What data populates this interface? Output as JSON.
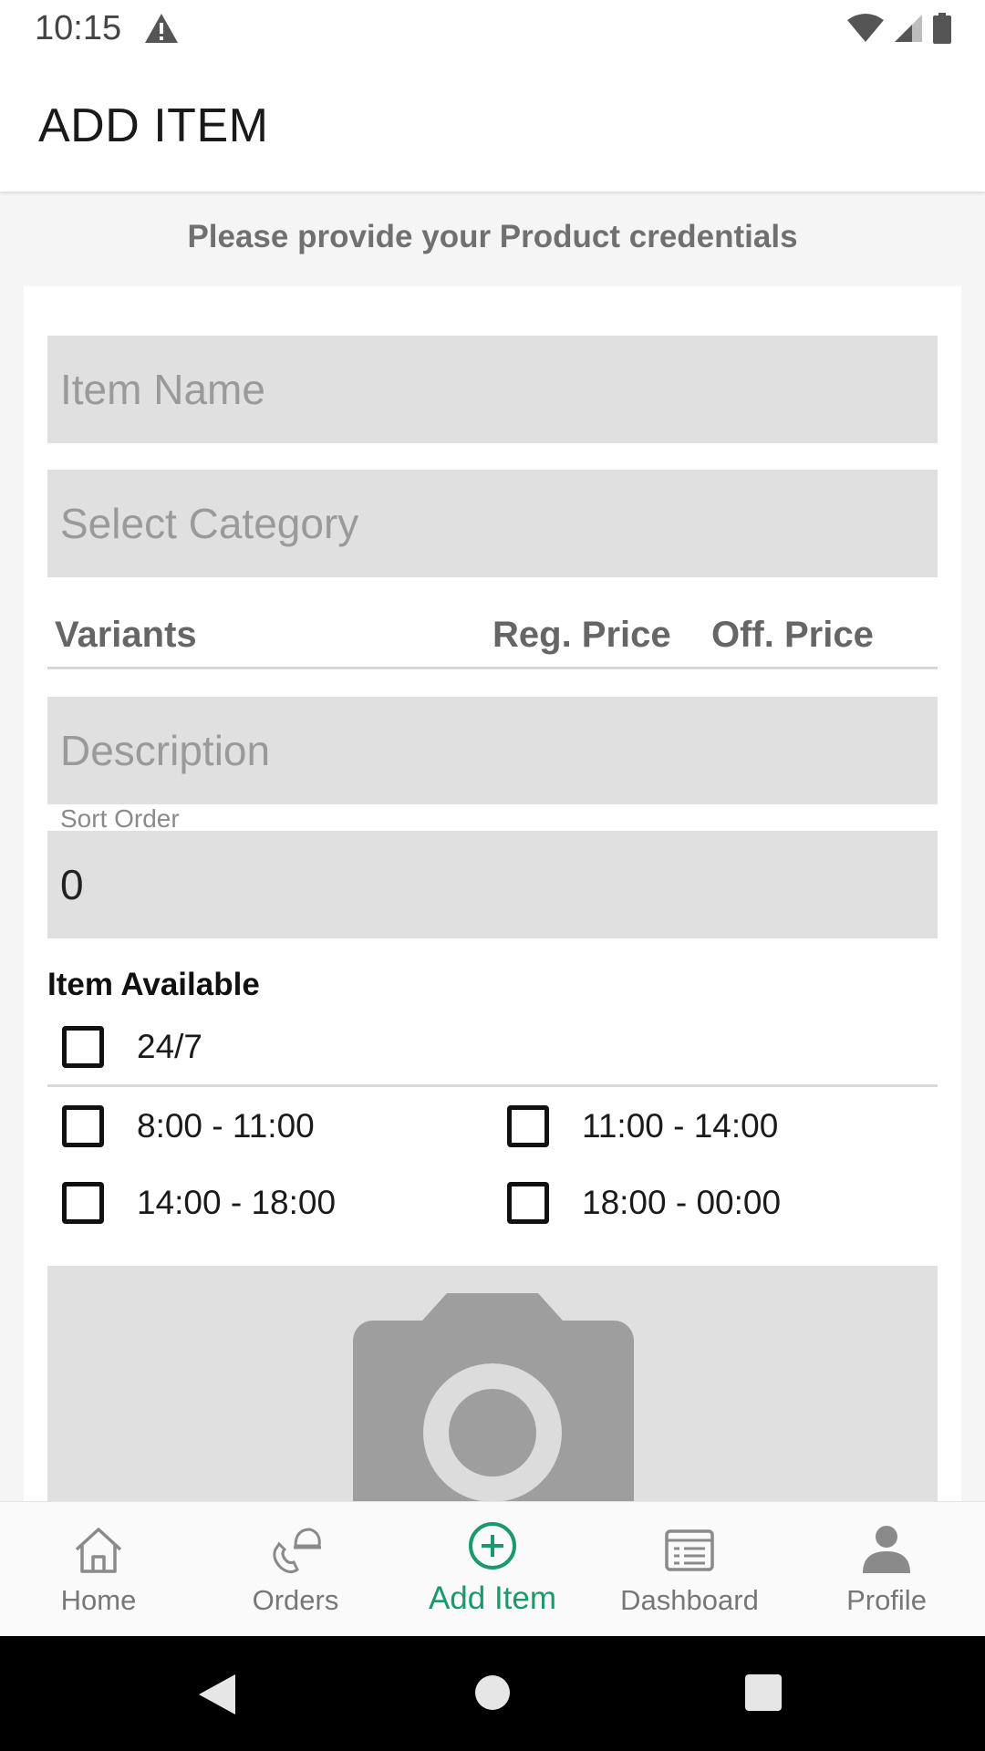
{
  "status_bar": {
    "time": "10:15"
  },
  "app_bar": {
    "title": "ADD ITEM"
  },
  "form": {
    "subtitle": "Please provide your Product credentials",
    "item_name_placeholder": "Item Name",
    "category_placeholder": "Select Category",
    "variants_header": {
      "variants": "Variants",
      "reg_price": "Reg. Price",
      "off_price": "Off. Price"
    },
    "description_placeholder": "Description",
    "sort_order_label": "Sort Order",
    "sort_order_value": "0",
    "availability": {
      "title": "Item Available",
      "all_day": "24/7",
      "slots": [
        "8:00 - 11:00",
        "11:00 - 14:00",
        "14:00 - 18:00",
        "18:00 - 00:00"
      ]
    }
  },
  "bottom_nav": {
    "items": [
      {
        "label": "Home",
        "icon": "home-icon"
      },
      {
        "label": "Orders",
        "icon": "orders-icon"
      },
      {
        "label": "Add Item",
        "icon": "add-circle-icon",
        "active": true
      },
      {
        "label": "Dashboard",
        "icon": "dashboard-icon"
      },
      {
        "label": "Profile",
        "icon": "profile-icon"
      }
    ]
  },
  "colors": {
    "accent": "#1a9a6b",
    "field_bg": "#e0e0e0",
    "icon_gray": "#9e9e9e"
  }
}
